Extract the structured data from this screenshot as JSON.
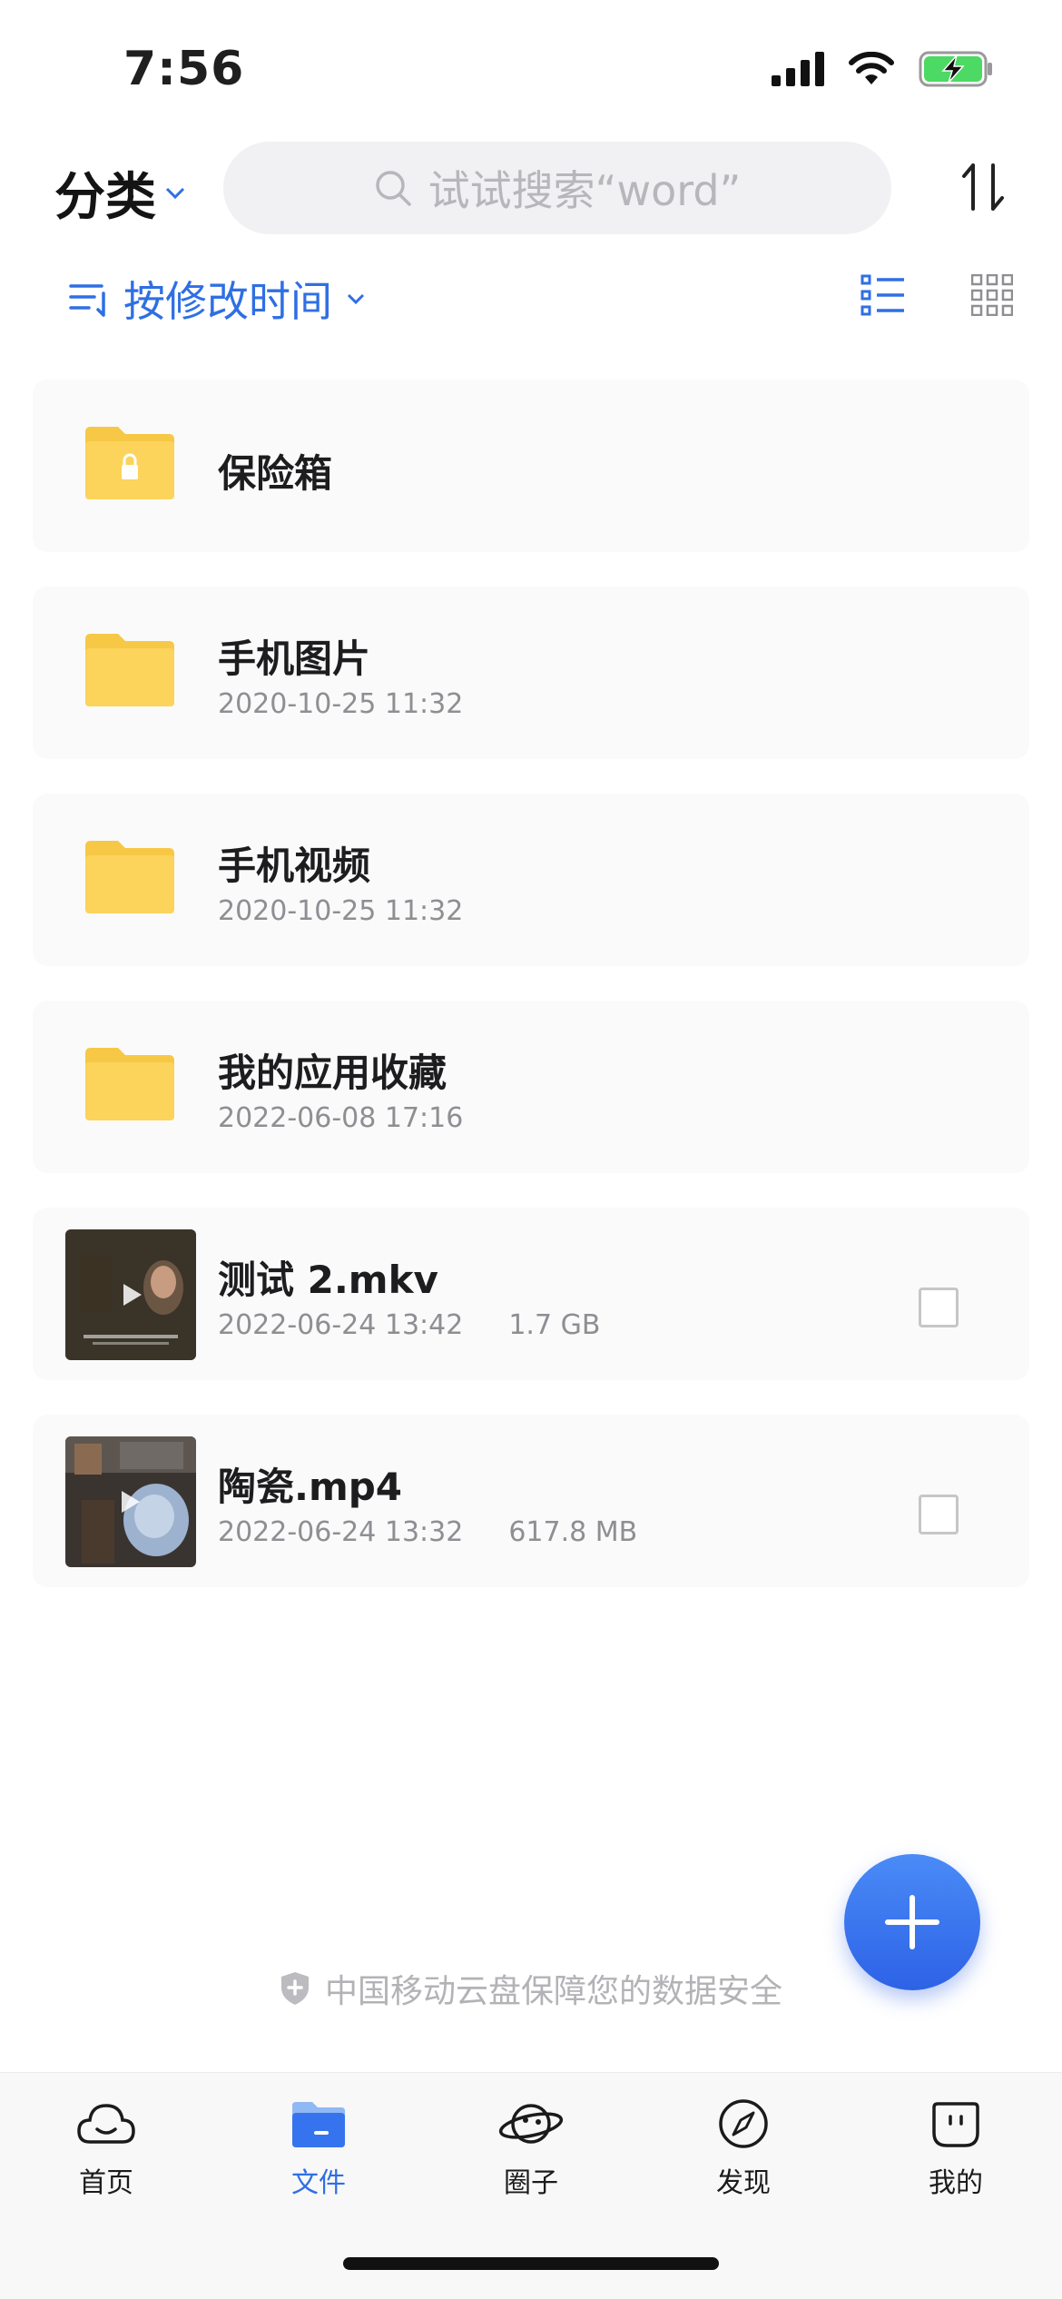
{
  "status": {
    "time": "7:56"
  },
  "header": {
    "category_label": "分类",
    "search_placeholder": "试试搜索“word”"
  },
  "sort": {
    "label": "按修改时间"
  },
  "files": [
    {
      "name": "保险箱",
      "date": "",
      "size": "",
      "type": "locked-folder"
    },
    {
      "name": "手机图片",
      "date": "2020-10-25 11:32",
      "size": "",
      "type": "folder"
    },
    {
      "name": "手机视频",
      "date": "2020-10-25 11:32",
      "size": "",
      "type": "folder"
    },
    {
      "name": "我的应用收藏",
      "date": "2022-06-08 17:16",
      "size": "",
      "type": "folder"
    },
    {
      "name": "测试 2.mkv",
      "date": "2022-06-24 13:42",
      "size": "1.7 GB",
      "type": "video"
    },
    {
      "name": "陶瓷.mp4",
      "date": "2022-06-24 13:32",
      "size": "617.8 MB",
      "type": "video"
    }
  ],
  "security_note": "中国移动云盘保障您的数据安全",
  "tabs": [
    {
      "label": "首页",
      "icon": "home-cloud-icon",
      "active": false
    },
    {
      "label": "文件",
      "icon": "file-folder-icon",
      "active": true
    },
    {
      "label": "圈子",
      "icon": "planet-icon",
      "active": false
    },
    {
      "label": "发现",
      "icon": "compass-icon",
      "active": false
    },
    {
      "label": "我的",
      "icon": "profile-face-icon",
      "active": false
    }
  ],
  "colors": {
    "accent": "#2f6fe4",
    "folder": "#fcd35b",
    "fab": "#3574ee"
  }
}
